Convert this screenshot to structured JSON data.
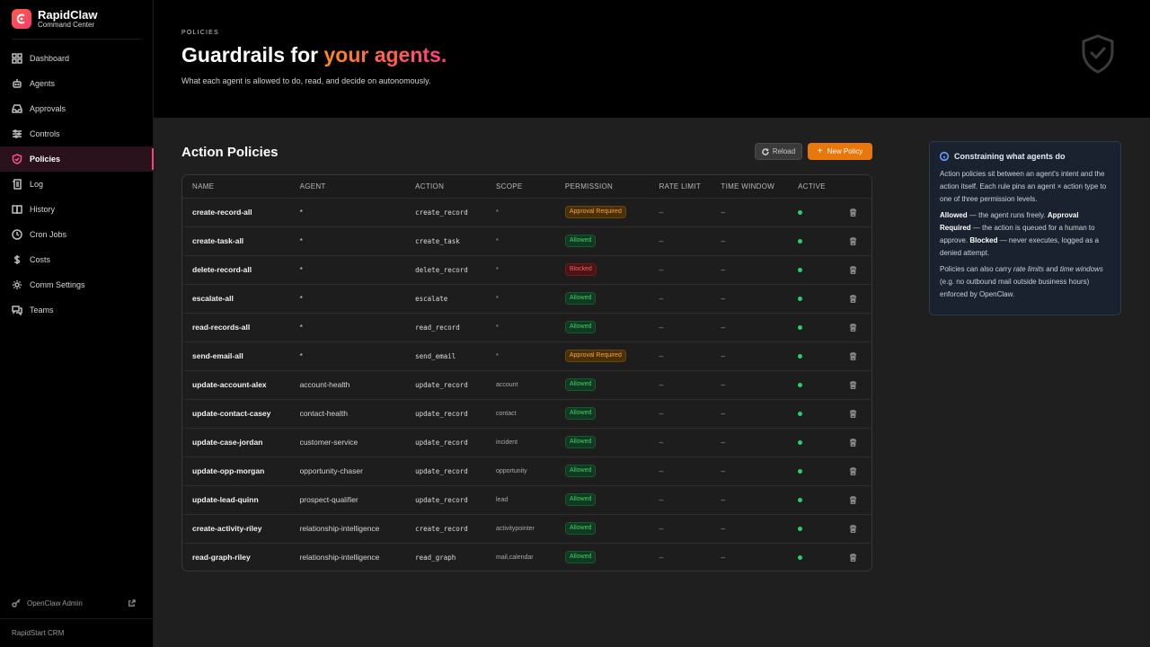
{
  "brand": {
    "name": "RapidClaw",
    "subtitle": "Command Center"
  },
  "nav": [
    {
      "label": "Dashboard",
      "icon": "grid-icon"
    },
    {
      "label": "Agents",
      "icon": "robot-icon"
    },
    {
      "label": "Approvals",
      "icon": "inbox-icon"
    },
    {
      "label": "Controls",
      "icon": "sliders-icon"
    },
    {
      "label": "Policies",
      "icon": "shield-icon",
      "active": true
    },
    {
      "label": "Log",
      "icon": "scroll-icon"
    },
    {
      "label": "History",
      "icon": "book-icon"
    },
    {
      "label": "Cron Jobs",
      "icon": "clock-icon"
    },
    {
      "label": "Costs",
      "icon": "dollar-icon"
    },
    {
      "label": "Comm Settings",
      "icon": "gear-icon"
    },
    {
      "label": "Teams",
      "icon": "chat-icon"
    }
  ],
  "footer": {
    "admin_label": "OpenClaw Admin",
    "crm_label": "RapidStart CRM"
  },
  "header": {
    "eyebrow": "POLICIES",
    "title_start": "Guardrails for ",
    "title_accent": "your agents.",
    "subtitle": "What each agent is allowed to do, read, and decide on autonomously."
  },
  "section": {
    "title": "Action Policies",
    "reload_label": "Reload",
    "new_label": "New Policy"
  },
  "table": {
    "columns": [
      "NAME",
      "AGENT",
      "ACTION",
      "SCOPE",
      "PERMISSION",
      "RATE LIMIT",
      "TIME WINDOW",
      "ACTIVE"
    ],
    "rows": [
      {
        "name": "create-record-all",
        "agent": "*",
        "action": "create_record",
        "scope": "*",
        "permission": "Approval Required",
        "rate": "–",
        "window": "–"
      },
      {
        "name": "create-task-all",
        "agent": "*",
        "action": "create_task",
        "scope": "*",
        "permission": "Allowed",
        "rate": "–",
        "window": "–"
      },
      {
        "name": "delete-record-all",
        "agent": "*",
        "action": "delete_record",
        "scope": "*",
        "permission": "Blocked",
        "rate": "–",
        "window": "–"
      },
      {
        "name": "escalate-all",
        "agent": "*",
        "action": "escalate",
        "scope": "*",
        "permission": "Allowed",
        "rate": "–",
        "window": "–"
      },
      {
        "name": "read-records-all",
        "agent": "*",
        "action": "read_record",
        "scope": "*",
        "permission": "Allowed",
        "rate": "–",
        "window": "–"
      },
      {
        "name": "send-email-all",
        "agent": "*",
        "action": "send_email",
        "scope": "*",
        "permission": "Approval Required",
        "rate": "–",
        "window": "–"
      },
      {
        "name": "update-account-alex",
        "agent": "account-health",
        "action": "update_record",
        "scope": "account",
        "permission": "Allowed",
        "rate": "–",
        "window": "–"
      },
      {
        "name": "update-contact-casey",
        "agent": "contact-health",
        "action": "update_record",
        "scope": "contact",
        "permission": "Allowed",
        "rate": "–",
        "window": "–"
      },
      {
        "name": "update-case-jordan",
        "agent": "customer-service",
        "action": "update_record",
        "scope": "incident",
        "permission": "Allowed",
        "rate": "–",
        "window": "–"
      },
      {
        "name": "update-opp-morgan",
        "agent": "opportunity-chaser",
        "action": "update_record",
        "scope": "opportunity",
        "permission": "Allowed",
        "rate": "–",
        "window": "–"
      },
      {
        "name": "update-lead-quinn",
        "agent": "prospect-qualifier",
        "action": "update_record",
        "scope": "lead",
        "permission": "Allowed",
        "rate": "–",
        "window": "–"
      },
      {
        "name": "create-activity-riley",
        "agent": "relationship-intelligence",
        "action": "create_record",
        "scope": "activitypointer",
        "permission": "Allowed",
        "rate": "–",
        "window": "–"
      },
      {
        "name": "read-graph-riley",
        "agent": "relationship-intelligence",
        "action": "read_graph",
        "scope": "mail,calendar",
        "permission": "Allowed",
        "rate": "–",
        "window": "–"
      }
    ]
  },
  "info": {
    "title": "Constraining what agents do",
    "p1": "Action policies sit between an agent's intent and the action itself. Each rule pins an agent × action type to one of three permission levels.",
    "p2_allowed": "Allowed",
    "p2_a": " — the agent runs freely. ",
    "p2_approval": "Approval Required",
    "p2_b": " — the action is queued for a human to approve. ",
    "p2_blocked": "Blocked",
    "p2_c": " — never executes, logged as a denied attempt.",
    "p3_a": "Policies can also carry ",
    "p3_rate": "rate limits",
    "p3_and": " and ",
    "p3_time": "time windows",
    "p3_b": " (e.g. no outbound mail outside business hours) enforced by OpenClaw."
  },
  "colors": {
    "accent_orange": "#e8780c",
    "accent_pink": "#ff3d7f",
    "active_dot": "#22d36a"
  }
}
